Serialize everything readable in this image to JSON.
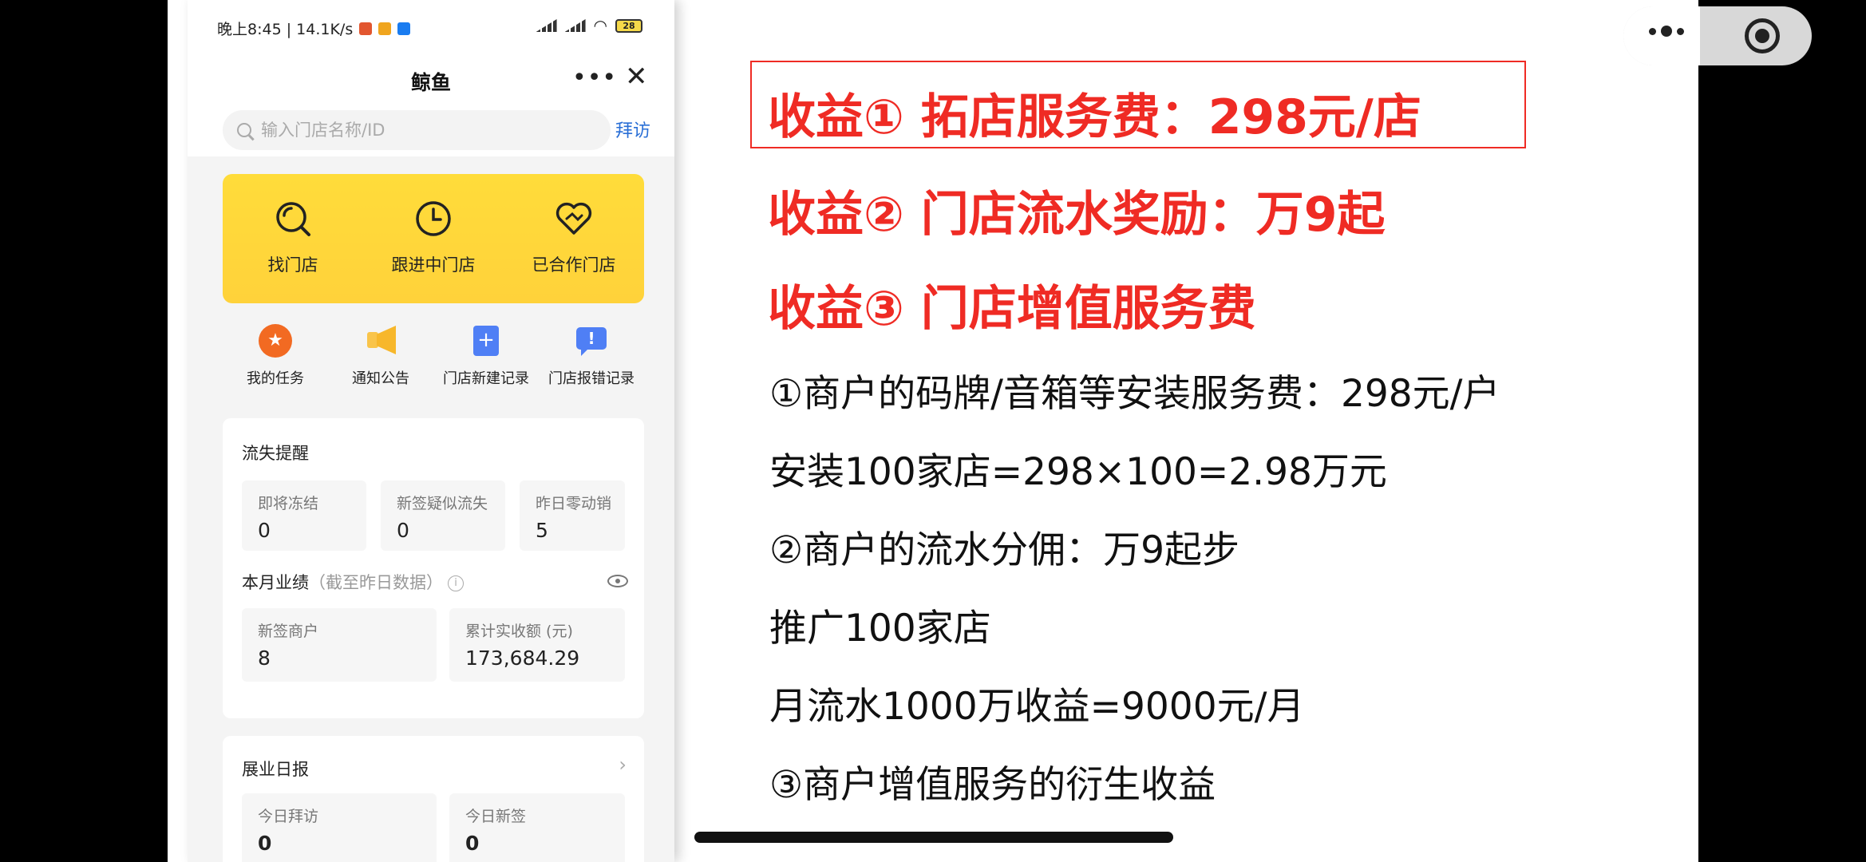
{
  "phone": {
    "status": {
      "time": "晚上8:45 | 14.1K/s",
      "battery": "28"
    },
    "title": "鲸鱼",
    "search": {
      "placeholder": "输入门店名称/ID",
      "visit_label": "拜访"
    },
    "main_actions": [
      {
        "label": "找门店",
        "icon": "search-store-icon"
      },
      {
        "label": "跟进中门店",
        "icon": "clock-icon"
      },
      {
        "label": "已合作门店",
        "icon": "handshake-heart-icon"
      }
    ],
    "quick_actions": [
      {
        "label": "我的任务",
        "icon": "star-badge-icon",
        "color": "#f26a22"
      },
      {
        "label": "通知公告",
        "icon": "megaphone-icon",
        "color": "#f7b72b"
      },
      {
        "label": "门店新建记录",
        "icon": "document-plus-icon",
        "color": "#4f7ff5"
      },
      {
        "label": "门店报错记录",
        "icon": "message-alert-icon",
        "color": "#4f7ff5"
      }
    ],
    "loss_alert": {
      "title": "流失提醒",
      "items": [
        {
          "label": "即将冻结",
          "value": "0"
        },
        {
          "label": "新签疑似流失",
          "value": "0"
        },
        {
          "label": "昨日零动销",
          "value": "5"
        }
      ]
    },
    "monthly": {
      "title": "本月业绩",
      "subtitle": "（截至昨日数据）",
      "items": [
        {
          "label": "新签商户",
          "value": "8"
        },
        {
          "label": "累计实收额 (元)",
          "value": "173,684.29"
        }
      ]
    },
    "daily": {
      "title": "展业日报",
      "items": [
        {
          "label": "今日拜访",
          "value": "0"
        },
        {
          "label": "今日新签",
          "value": "0"
        }
      ]
    }
  },
  "slide": {
    "income1": "收益① 拓店服务费：298元/店",
    "income2": "收益② 门店流水奖励：万9起",
    "income3": "收益③ 门店增值服务费",
    "line1": "①商户的码牌/音箱等安装服务费：298元/户",
    "line2": "安装100家店=298×100=2.98万元",
    "line3": "②商户的流水分佣：万9起步",
    "line4": "推广100家店",
    "line5": "月流水1000万收益=9000元/月",
    "line6": "③商户增值服务的衍生收益"
  },
  "colors": {
    "highlight_red": "#ef2b24",
    "brand_yellow": "#ffd23a",
    "link_blue": "#2a6fd6"
  }
}
